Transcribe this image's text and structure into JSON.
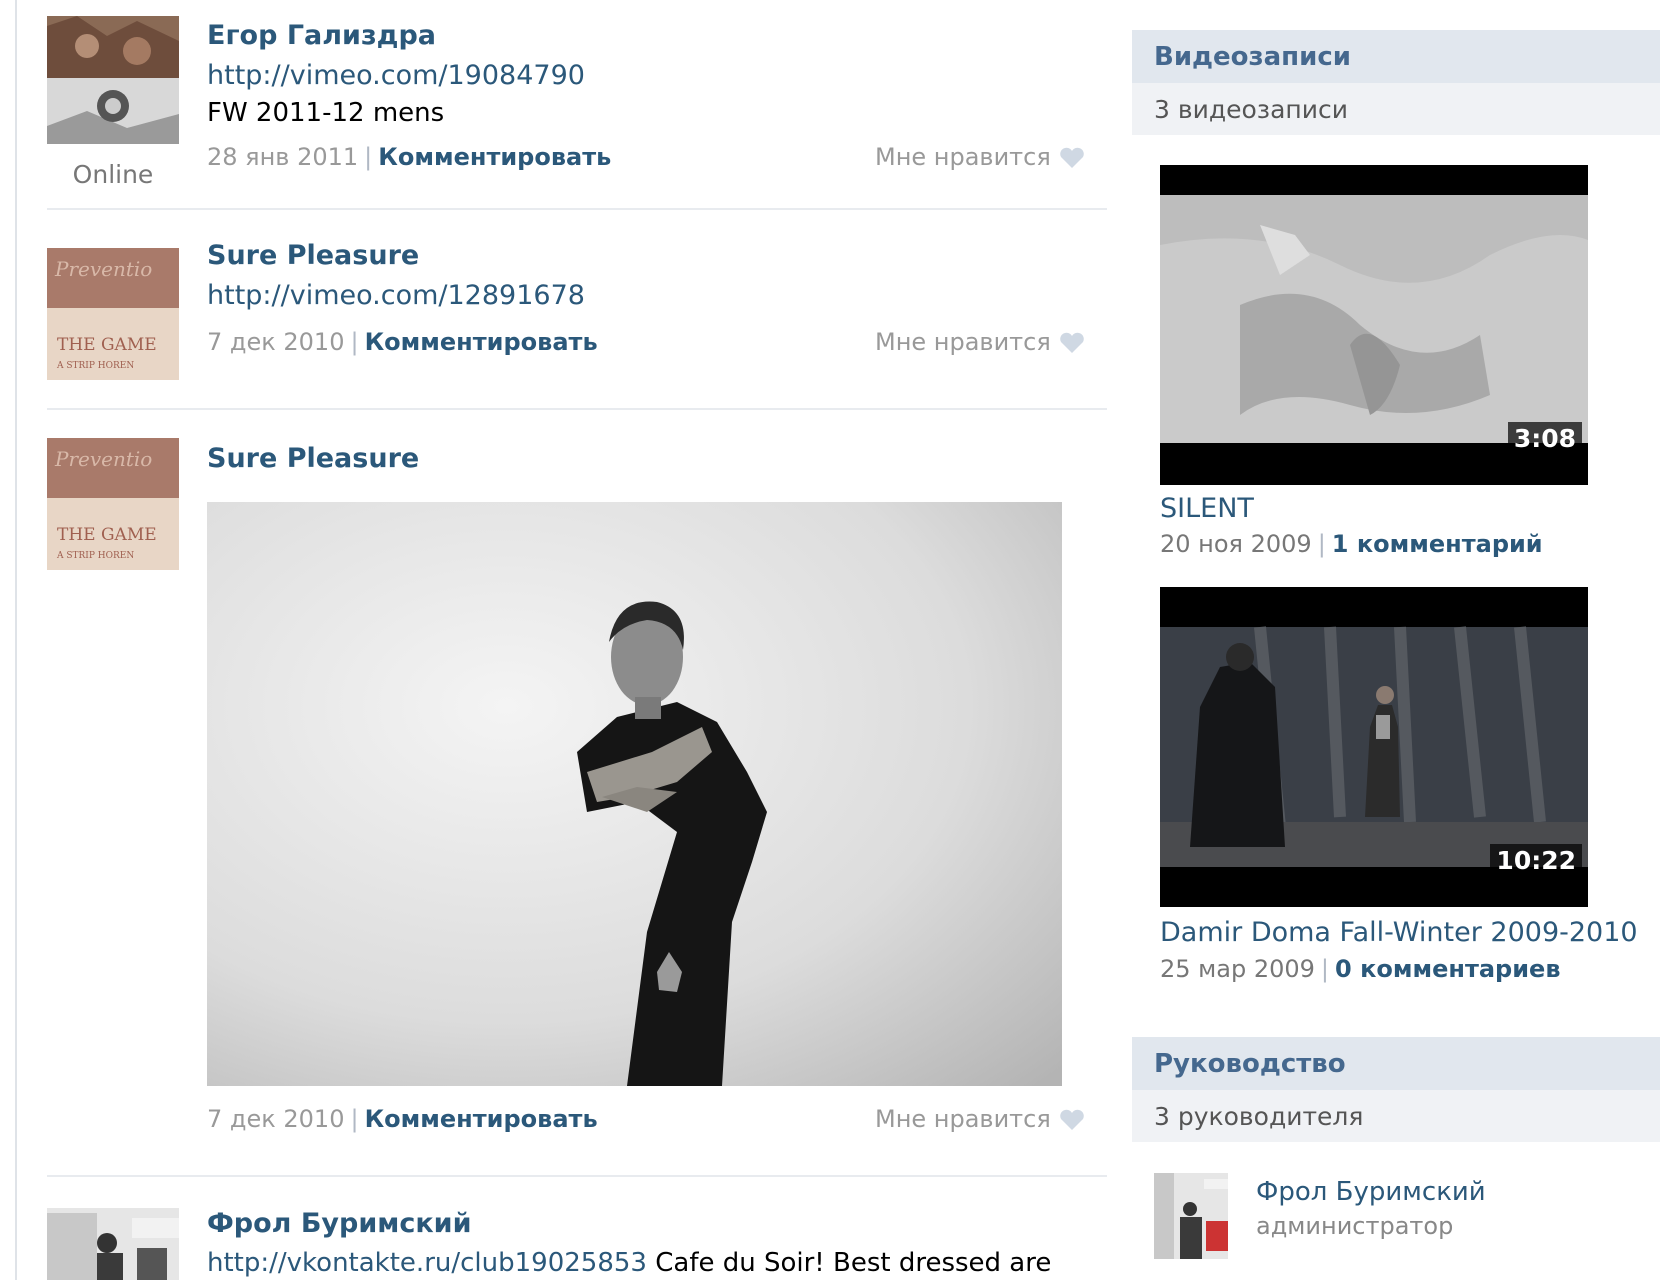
{
  "posts": [
    {
      "author": "Егор Гализдра",
      "link": "http://vimeo.com/19084790",
      "text": "FW 2011-12 mens",
      "date": "28 янв 2011",
      "separator": "|",
      "comment": "Комментировать",
      "like": "Мне нравится",
      "status": "Online"
    },
    {
      "author": "Sure Pleasure",
      "link": "http://vimeo.com/12891678",
      "date": "7 дек 2010",
      "separator": "|",
      "comment": "Комментировать",
      "like": "Мне нравится",
      "avatar_text": [
        "THE GAME",
        "A STRIP HOREN"
      ]
    },
    {
      "author": "Sure Pleasure",
      "date": "7 дек 2010",
      "separator": "|",
      "comment": "Комментировать",
      "like": "Мне нравится",
      "avatar_text": [
        "THE GAME",
        "A STRIP HOREN"
      ]
    },
    {
      "author": "Фрол Буримский",
      "link": "http://vkontakte.ru/club19025853",
      "text": "Cafe du Soir! Best dressed are"
    }
  ],
  "sidebar": {
    "videos": {
      "title": "Видеозаписи",
      "count": "3 видеозаписи",
      "items": [
        {
          "title": "SILENT",
          "duration": "3:08",
          "date": "20 ноя 2009",
          "separator": "|",
          "comments": "1 комментарий"
        },
        {
          "title": "Damir Doma Fall-Winter 2009-2010",
          "duration": "10:22",
          "date": "25 мар 2009",
          "separator": "|",
          "comments": "0 комментариев"
        }
      ]
    },
    "management": {
      "title": "Руководство",
      "count": "3 руководителя",
      "members": [
        {
          "name": "Фрол Буримский",
          "role": "администратор"
        }
      ]
    }
  },
  "colors": {
    "link": "#2b587a",
    "header_bg": "#e1e7ee",
    "header_text": "#45688e",
    "heart": "#cfd8e3"
  }
}
